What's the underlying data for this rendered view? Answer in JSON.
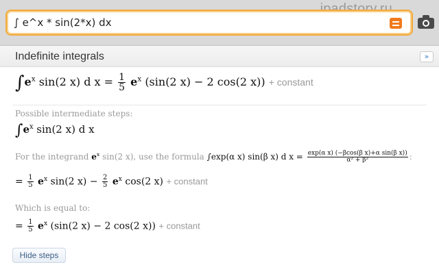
{
  "watermark": "ipadstory.ru",
  "search": {
    "query": "∫ e^x * sin(2*x) dx"
  },
  "pod": {
    "title": "Indefinite integrals",
    "expand_glyph": "»"
  },
  "result": {
    "integral": "∫",
    "lhs_rest": "sin(2 x) d x =",
    "frac_num": "1",
    "frac_den": "5",
    "rhs": "(sin(2 x) − 2 cos(2 x))",
    "constant": "+ constant"
  },
  "steps": {
    "heading": "Possible intermediate steps:",
    "step1": "sin(2 x) d x",
    "formula_intro_a": "For the integrand",
    "formula_intro_b": "sin(2 x), use the formula",
    "formula_lhs": "∫exp(α x) sin(β x) d x =",
    "formula_num": "exp(α x) (−βcos(β x)+α sin(β x))",
    "formula_den": "α² + β²",
    "colon": ":",
    "step2_a": "sin(2 x) −",
    "step2_frac_num": "2",
    "step2_b": "cos(2 x)",
    "equal_heading": "Which is equal to:",
    "step3": "(sin(2 x) − 2 cos(2 x))",
    "eq": "=",
    "e": "e",
    "x": "x"
  },
  "hide_steps": "Hide steps"
}
